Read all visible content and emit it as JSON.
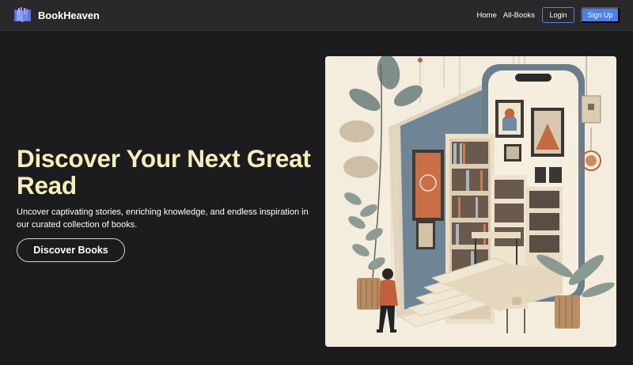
{
  "brand": {
    "name": "BookHeaven",
    "logo_icon": "open-book-logo-icon"
  },
  "nav": {
    "links": [
      "Home",
      "All-Books"
    ],
    "login_label": "Login",
    "signup_label": "Sign Up"
  },
  "hero": {
    "title": "Discover Your Next Great Read",
    "subtitle": "Uncover captivating stories, enriching knowledge, and endless inspiration in our curated collection of books.",
    "cta_label": "Discover Books",
    "illustration_icon": "reading-illustration"
  },
  "colors": {
    "background": "#1c1b1d",
    "navbar": "#29292b",
    "accent": "#4a80f0",
    "title": "#f7eebc"
  }
}
